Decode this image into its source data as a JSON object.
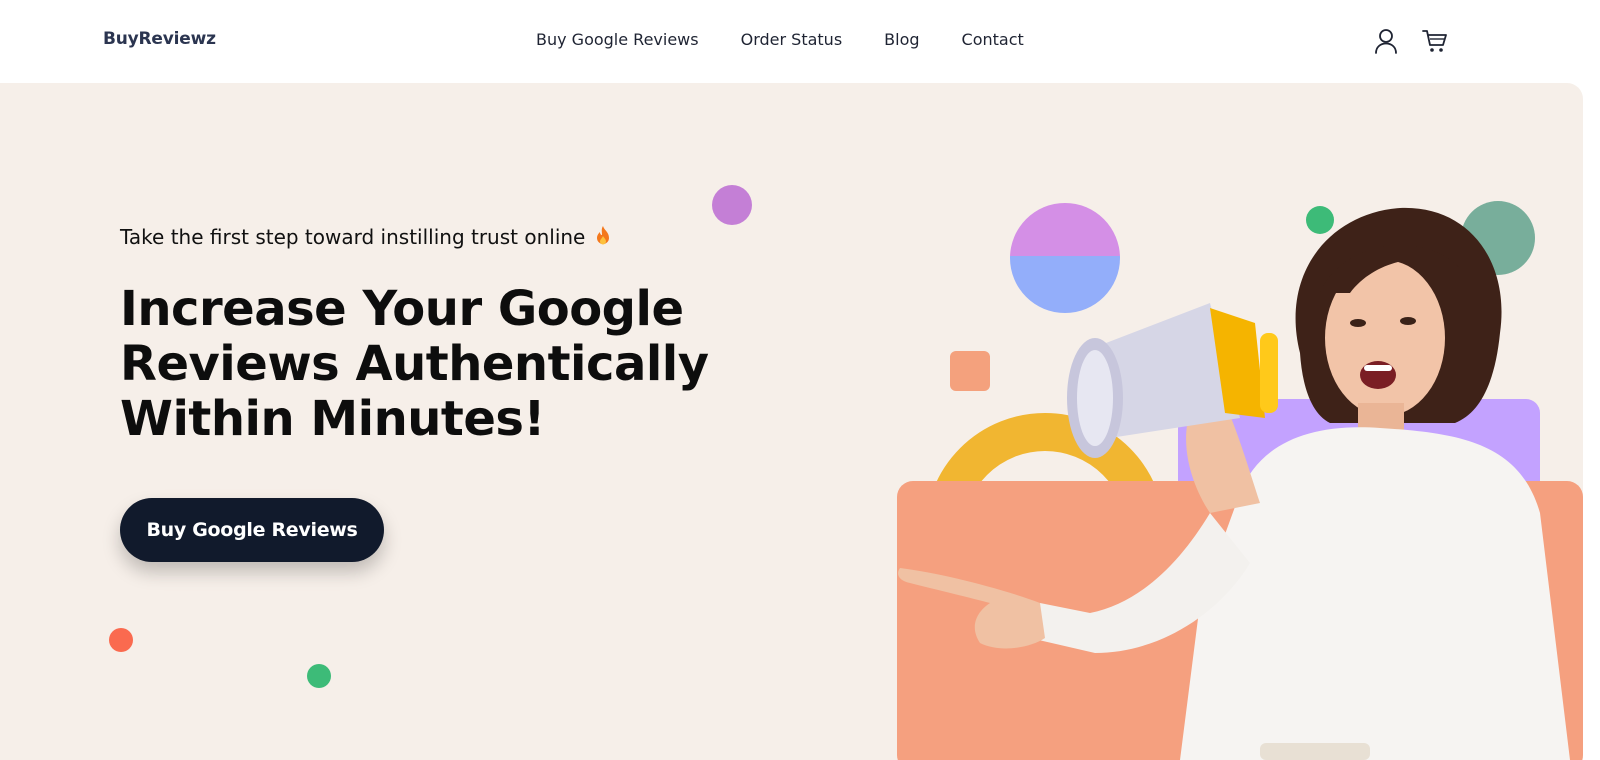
{
  "header": {
    "logo": "BuyReviewz",
    "nav": [
      "Buy Google Reviews",
      "Order Status",
      "Blog",
      "Contact"
    ],
    "icons": [
      "user-icon",
      "cart-icon"
    ]
  },
  "hero": {
    "tagline": "Take the first step toward instilling trust online",
    "headline": "Increase Your Google Reviews Authentically Within Minutes!",
    "cta": "Buy Google Reviews"
  },
  "colors": {
    "hero_bg": "#f6efe9",
    "cta_bg": "#111a2c",
    "accent_salmon": "#f5a07f",
    "accent_yellow": "#f1b631",
    "accent_lilac": "#c3a2ff",
    "accent_green": "#3dbb78",
    "accent_purple": "#c47fd6"
  }
}
